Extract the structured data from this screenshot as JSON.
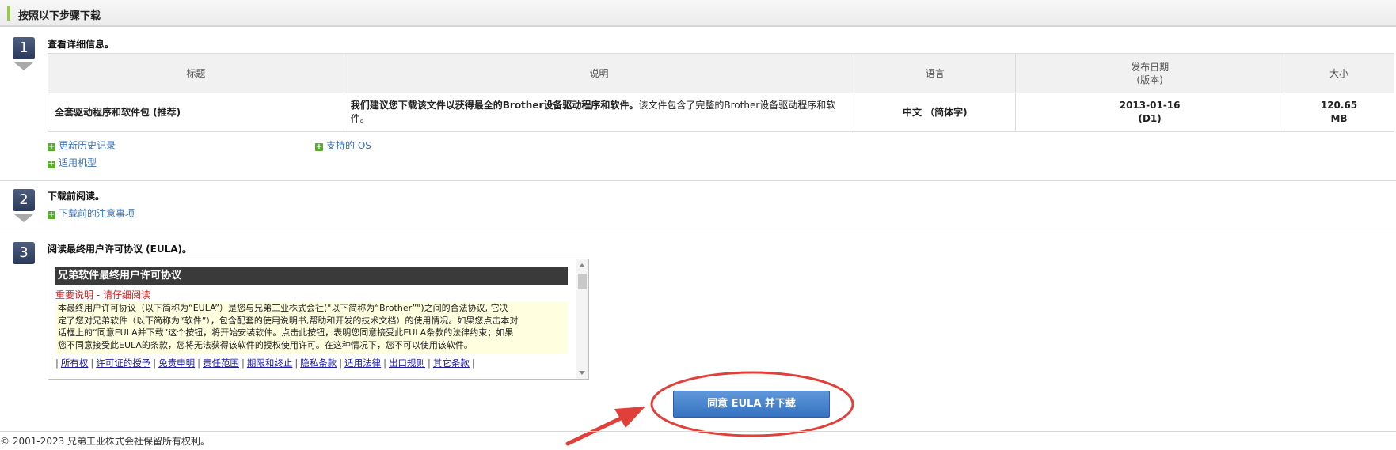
{
  "header": {
    "title": "按照以下步骤下载"
  },
  "steps": [
    {
      "number": "1",
      "title": "查看详细信息。"
    },
    {
      "number": "2",
      "title": "下载前阅读。"
    },
    {
      "number": "3",
      "title": "阅读最终用户许可协议 (EULA)。"
    }
  ],
  "details_table": {
    "headers": [
      "标题",
      "说明",
      "语言",
      "发布日期",
      "(版本)",
      "大小"
    ],
    "row": {
      "title": "全套驱动程序和软件包 (推荐)",
      "description_bold": "我们建议您下载该文件以获得最全的Brother设备驱动程序和软件。",
      "description_normal": "该文件包含了完整的Brother设备驱动程序和软件。",
      "language": "中文 （简体字)",
      "date": "2013-01-16",
      "version": "(D1)",
      "size_value": "120.65",
      "size_unit": "MB"
    }
  },
  "links": {
    "revision_history": "更新历史记录",
    "supported_os": "支持的 OS",
    "applicable_models": "适用机型",
    "download_notes": "下载前的注意事项"
  },
  "eula": {
    "heading": "兄弟软件最终用户许可协议",
    "important": "重要说明 - 请仔细阅读",
    "body_line1": "本最终用户许可协议（以下简称为“EULA”）是您与兄弟工业株式会社(\"以下简称为“Brother”\")之间的合法协议, 它决",
    "body_line2": "定了您对兄弟软件（以下简称为“软件”），包含配套的使用说明书,帮助和开发的技术文档）的使用情况。如果您点击本对",
    "body_line3": "话框上的“同意EULA并下载”这个按钮，将开始安装软件。点击此按钮，表明您同意接受此EULA条款的法律约束；如果",
    "body_line4": "您不同意接受此EULA的条款，您将无法获得该软件的授权使用许可。在这种情况下，您不可以使用该软件。",
    "links": [
      "所有权",
      "许可证的授予",
      "免责申明",
      "责任范围",
      "期限和终止",
      "隐私条款",
      "适用法律",
      "出口规则",
      "其它条款"
    ]
  },
  "agree_button": "同意 EULA 并下载",
  "footer": "© 2001-2023 兄弟工业株式会社保留所有权利。",
  "colors": {
    "annotation": "#e0403a",
    "button": "#3f7cc7",
    "plus": "#5aac30"
  }
}
